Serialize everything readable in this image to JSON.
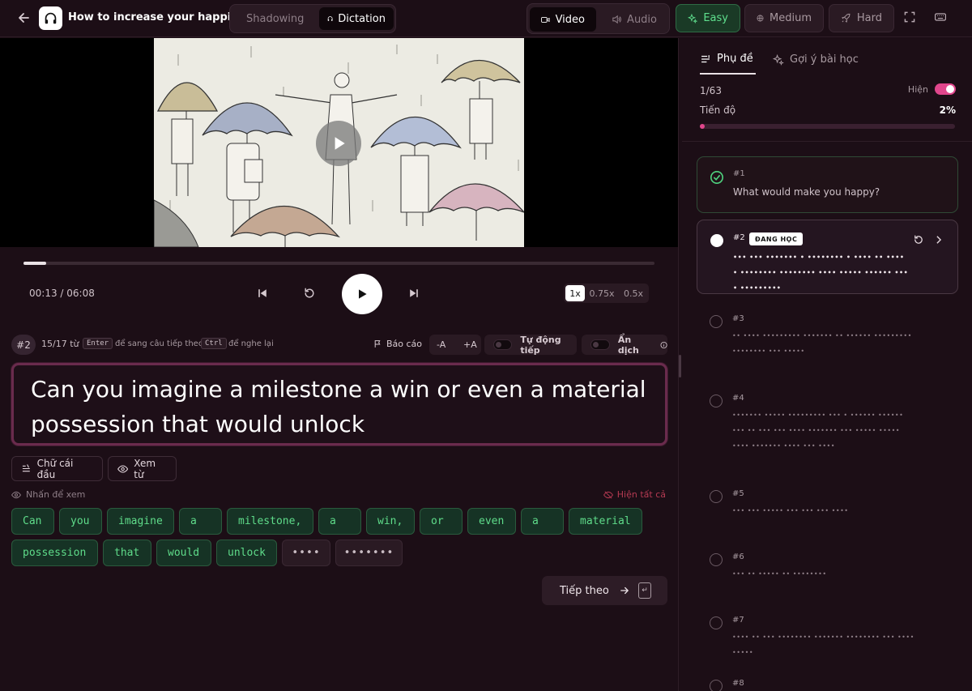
{
  "header": {
    "title": "How to increase your happiness",
    "modes": [
      {
        "label": "Shadowing"
      },
      {
        "label": "Dictation"
      }
    ],
    "media": [
      {
        "label": "Video"
      },
      {
        "label": "Audio"
      }
    ],
    "levels": [
      {
        "label": "Easy"
      },
      {
        "label": "Medium"
      },
      {
        "label": "Hard"
      }
    ]
  },
  "player": {
    "time": "00:13 / 06:08",
    "progress_fraction": 0.036,
    "speeds": [
      "1x",
      "0.75x",
      "0.5x"
    ],
    "selected_speed": "1x"
  },
  "info": {
    "sentence_badge": "#2",
    "word_count": "15/17 từ",
    "enter_key": "Enter",
    "enter_hint": "để sang câu tiếp theo",
    "ctrl_key": "Ctrl",
    "ctrl_hint": "để nghe lại",
    "report": "Báo cáo",
    "font_minus": "-A",
    "font_plus": "+A",
    "auto_next": "Tự động tiếp",
    "hide_translation": "Ẩn dịch"
  },
  "input": {
    "text": "Can you imagine a milestone a win or even a material possession that would unlock"
  },
  "hints": {
    "first_letter": "Chữ cái đầu",
    "view_word": "Xem từ",
    "tap_to_view": "Nhấn để xem",
    "show_all": "Hiện tất cả"
  },
  "words": [
    {
      "text": "Can",
      "revealed": true
    },
    {
      "text": "you",
      "revealed": true
    },
    {
      "text": "imagine",
      "revealed": true
    },
    {
      "text": "a",
      "revealed": true
    },
    {
      "text": "milestone,",
      "revealed": true
    },
    {
      "text": "a",
      "revealed": true
    },
    {
      "text": "win,",
      "revealed": true
    },
    {
      "text": "or",
      "revealed": true
    },
    {
      "text": "even",
      "revealed": true
    },
    {
      "text": "a",
      "revealed": true
    },
    {
      "text": "material",
      "revealed": true
    },
    {
      "text": "possession",
      "revealed": true
    },
    {
      "text": "that",
      "revealed": true
    },
    {
      "text": "would",
      "revealed": true
    },
    {
      "text": "unlock",
      "revealed": true
    },
    {
      "text": "••••",
      "revealed": false
    },
    {
      "text": "•••••••",
      "revealed": false
    }
  ],
  "next_button": "Tiếp theo",
  "panel": {
    "tabs": [
      {
        "label": "Phụ đề"
      },
      {
        "label": "Gợi ý bài học"
      }
    ],
    "count": "1/63",
    "show_label": "Hiện",
    "progress_label": "Tiến độ",
    "progress_pct": "2%",
    "progress_fraction": 0.02,
    "current_badge": "ĐANG HỌC",
    "items": [
      {
        "num": "#1",
        "text": "What would make you happy?"
      },
      {
        "num": "#2",
        "text": "••• ••• ••••••• • •••••••• • •••• •• •••• • •••••••• •••••••• •••• ••••• •••••• •••• •••••••••"
      },
      {
        "num": "#3",
        "text": "•• •••• ••••••••• ••••••• •• •••••• ••••••••• •••••••• ••• •••••"
      },
      {
        "num": "#4",
        "text": "••••••• ••••• ••••••••• ••• • •••••• ••••••••• •• ••• ••• •••• ••••••• ••• ••••• ••••• •••• ••••••• •••• ••• ••••"
      },
      {
        "num": "#5",
        "text": "••• ••• ••••• ••• ••• ••• ••••"
      },
      {
        "num": "#6",
        "text": "••• •• ••••• •• ••••••••"
      },
      {
        "num": "#7",
        "text": "•••• •• ••• •••••••• ••••••• •••••••• ••• •••••••••"
      },
      {
        "num": "#8",
        "text": ""
      }
    ]
  }
}
